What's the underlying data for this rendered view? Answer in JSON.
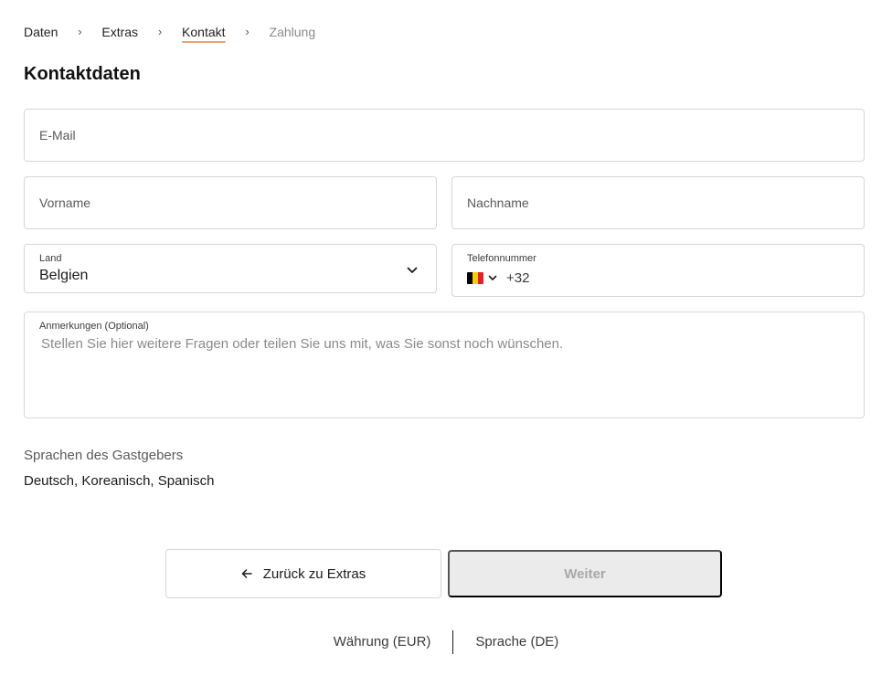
{
  "breadcrumb": {
    "items": [
      {
        "label": "Daten"
      },
      {
        "label": "Extras"
      },
      {
        "label": "Kontakt"
      },
      {
        "label": "Zahlung"
      }
    ]
  },
  "heading": "Kontaktdaten",
  "form": {
    "email": {
      "placeholder": "E-Mail",
      "value": ""
    },
    "first_name": {
      "placeholder": "Vorname",
      "value": ""
    },
    "last_name": {
      "placeholder": "Nachname",
      "value": ""
    },
    "country": {
      "label": "Land",
      "value": "Belgien"
    },
    "phone": {
      "label": "Telefonnummer",
      "dial_code": "+32",
      "flag": "belgium-flag-icon",
      "value": ""
    },
    "notes": {
      "label": "Anmerkungen (Optional)",
      "placeholder": "Stellen Sie hier weitere Fragen oder teilen Sie uns mit, was Sie sonst noch wünschen."
    }
  },
  "host_languages": {
    "title": "Sprachen des Gastgebers",
    "value": "Deutsch, Koreanisch, Spanisch"
  },
  "actions": {
    "back_label": "Zurück zu Extras",
    "next_label": "Weiter"
  },
  "footer": {
    "currency_label": "Währung (EUR)",
    "language_label": "Sprache (DE)"
  },
  "colors": {
    "active_underline": "#f0a070",
    "disabled_button_bg": "#ebebeb"
  }
}
